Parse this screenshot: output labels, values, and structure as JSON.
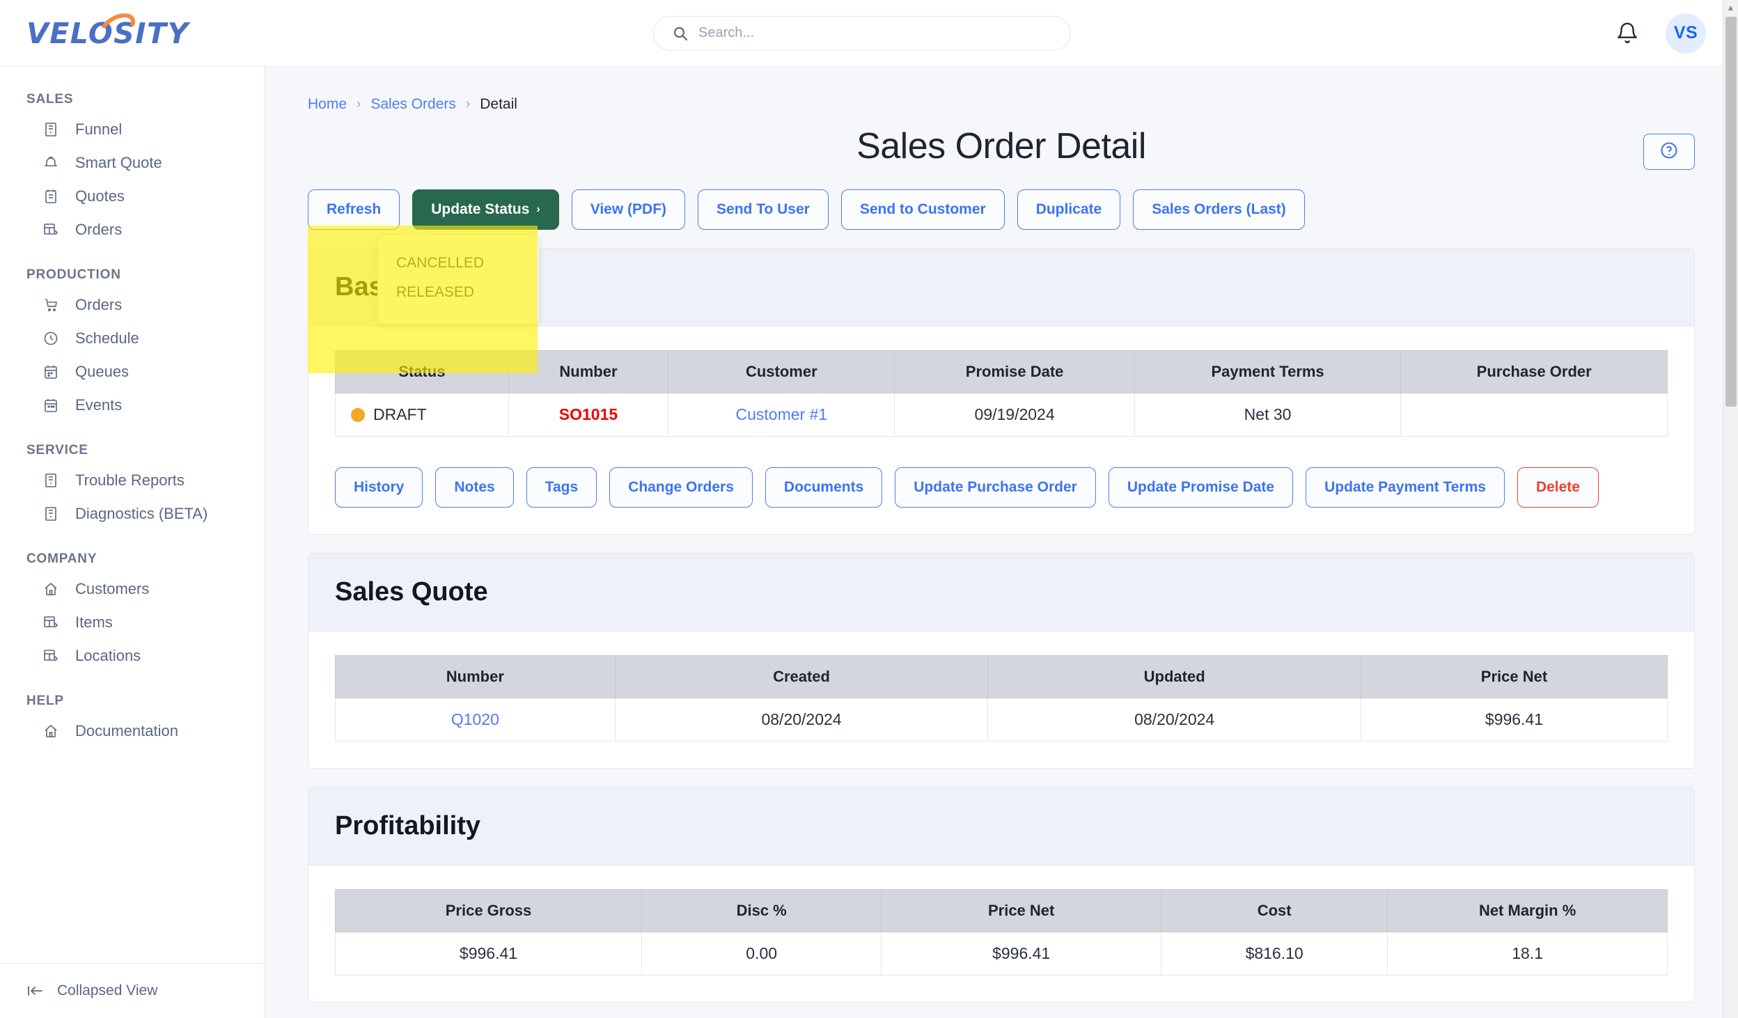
{
  "brand": {
    "name": "VELOSITY",
    "logo_primary": "#4a6fc4",
    "logo_accent": "#f68b3c"
  },
  "topbar": {
    "search_placeholder": "Search...",
    "search_value": "",
    "avatar_initials": "VS",
    "notifications_icon": "bell-icon"
  },
  "sidebar": {
    "groups": [
      {
        "label": "SALES",
        "items": [
          {
            "label": "Funnel",
            "icon": "building-icon"
          },
          {
            "label": "Smart Quote",
            "icon": "hard-hat-icon"
          },
          {
            "label": "Quotes",
            "icon": "notebook-icon"
          },
          {
            "label": "Orders",
            "icon": "grid-orders-icon"
          }
        ]
      },
      {
        "label": "PRODUCTION",
        "items": [
          {
            "label": "Orders",
            "icon": "cart-icon"
          },
          {
            "label": "Schedule",
            "icon": "clock-icon"
          },
          {
            "label": "Queues",
            "icon": "calendar-icon"
          },
          {
            "label": "Events",
            "icon": "calendar-icon"
          }
        ]
      },
      {
        "label": "SERVICE",
        "items": [
          {
            "label": "Trouble Reports",
            "icon": "building-icon"
          },
          {
            "label": "Diagnostics (BETA)",
            "icon": "building-icon"
          }
        ]
      },
      {
        "label": "COMPANY",
        "items": [
          {
            "label": "Customers",
            "icon": "home-icon"
          },
          {
            "label": "Items",
            "icon": "grid-orders-icon"
          },
          {
            "label": "Locations",
            "icon": "grid-orders-icon"
          }
        ]
      },
      {
        "label": "HELP",
        "items": [
          {
            "label": "Documentation",
            "icon": "home-icon"
          }
        ]
      }
    ],
    "footer": {
      "label": "Collapsed View",
      "icon": "collapse-left-icon"
    }
  },
  "breadcrumb": {
    "home": "Home",
    "sales_orders": "Sales Orders",
    "current": "Detail",
    "separator": "›"
  },
  "page": {
    "title": "Sales Order Detail",
    "help_icon": "question-circle-icon"
  },
  "toolbar": {
    "refresh": "Refresh",
    "update_status": "Update Status",
    "update_status_caret": "›",
    "view_pdf": "View (PDF)",
    "send_to_user": "Send To User",
    "send_to_customer": "Send to Customer",
    "duplicate": "Duplicate",
    "sales_orders_last": "Sales Orders (Last)"
  },
  "status_dropdown": {
    "open": true,
    "options": [
      "CANCELLED",
      "RELEASED"
    ]
  },
  "highlight": {
    "color": "#fff200",
    "opacity": 0.62
  },
  "basic_card": {
    "title": "Basic",
    "headers": [
      "Status",
      "Number",
      "Customer",
      "Promise Date",
      "Payment Terms",
      "Purchase Order"
    ],
    "row": {
      "status": "DRAFT",
      "status_color": "#f5a623",
      "number": "SO1015",
      "customer": "Customer #1",
      "promise_date": "09/19/2024",
      "payment_terms": "Net 30",
      "purchase_order": ""
    },
    "actions": [
      {
        "label": "History",
        "style": "link"
      },
      {
        "label": "Notes",
        "style": "link"
      },
      {
        "label": "Tags",
        "style": "link"
      },
      {
        "label": "Change Orders",
        "style": "link"
      },
      {
        "label": "Documents",
        "style": "link"
      },
      {
        "label": "Update Purchase Order",
        "style": "link"
      },
      {
        "label": "Update Promise Date",
        "style": "link"
      },
      {
        "label": "Update Payment Terms",
        "style": "link"
      },
      {
        "label": "Delete",
        "style": "danger"
      }
    ]
  },
  "sales_quote": {
    "title": "Sales Quote",
    "headers": [
      "Number",
      "Created",
      "Updated",
      "Price Net"
    ],
    "rows": [
      {
        "number": "Q1020",
        "created": "08/20/2024",
        "updated": "08/20/2024",
        "price_net": "$996.41"
      }
    ]
  },
  "profitability": {
    "title": "Profitability",
    "headers": [
      "Price Gross",
      "Disc %",
      "Price Net",
      "Cost",
      "Net Margin %"
    ],
    "rows": [
      {
        "price_gross": "$996.41",
        "disc_pct": "0.00",
        "price_net": "$996.41",
        "cost": "$816.10",
        "net_margin_pct": "18.1"
      }
    ]
  }
}
